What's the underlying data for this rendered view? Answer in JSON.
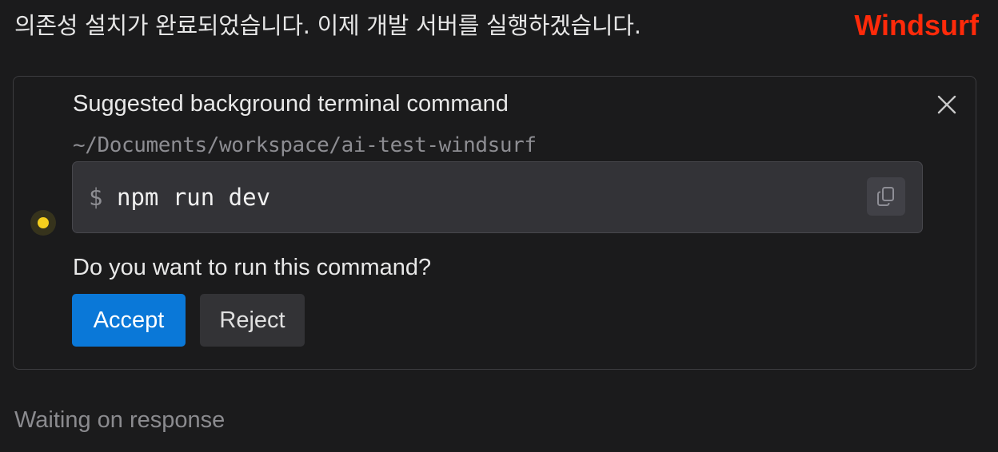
{
  "message": {
    "intro": "의존성 설치가 완료되었습니다. 이제 개발 서버를 실행하겠습니다."
  },
  "brand": {
    "label": "Windsurf",
    "color": "#ff2a0a"
  },
  "command_card": {
    "title": "Suggested background terminal command",
    "close_icon": "close-icon",
    "cwd": "~/Documents/workspace/ai-test-windsurf",
    "prompt_symbol": "$",
    "command": "npm run dev",
    "copy_icon": "copy-icon",
    "status_color": "#f5cf1e",
    "question": "Do you want to run this command?",
    "accept_label": "Accept",
    "reject_label": "Reject",
    "accept_color": "#0a78d8"
  },
  "status": {
    "waiting_text": "Waiting on response"
  }
}
